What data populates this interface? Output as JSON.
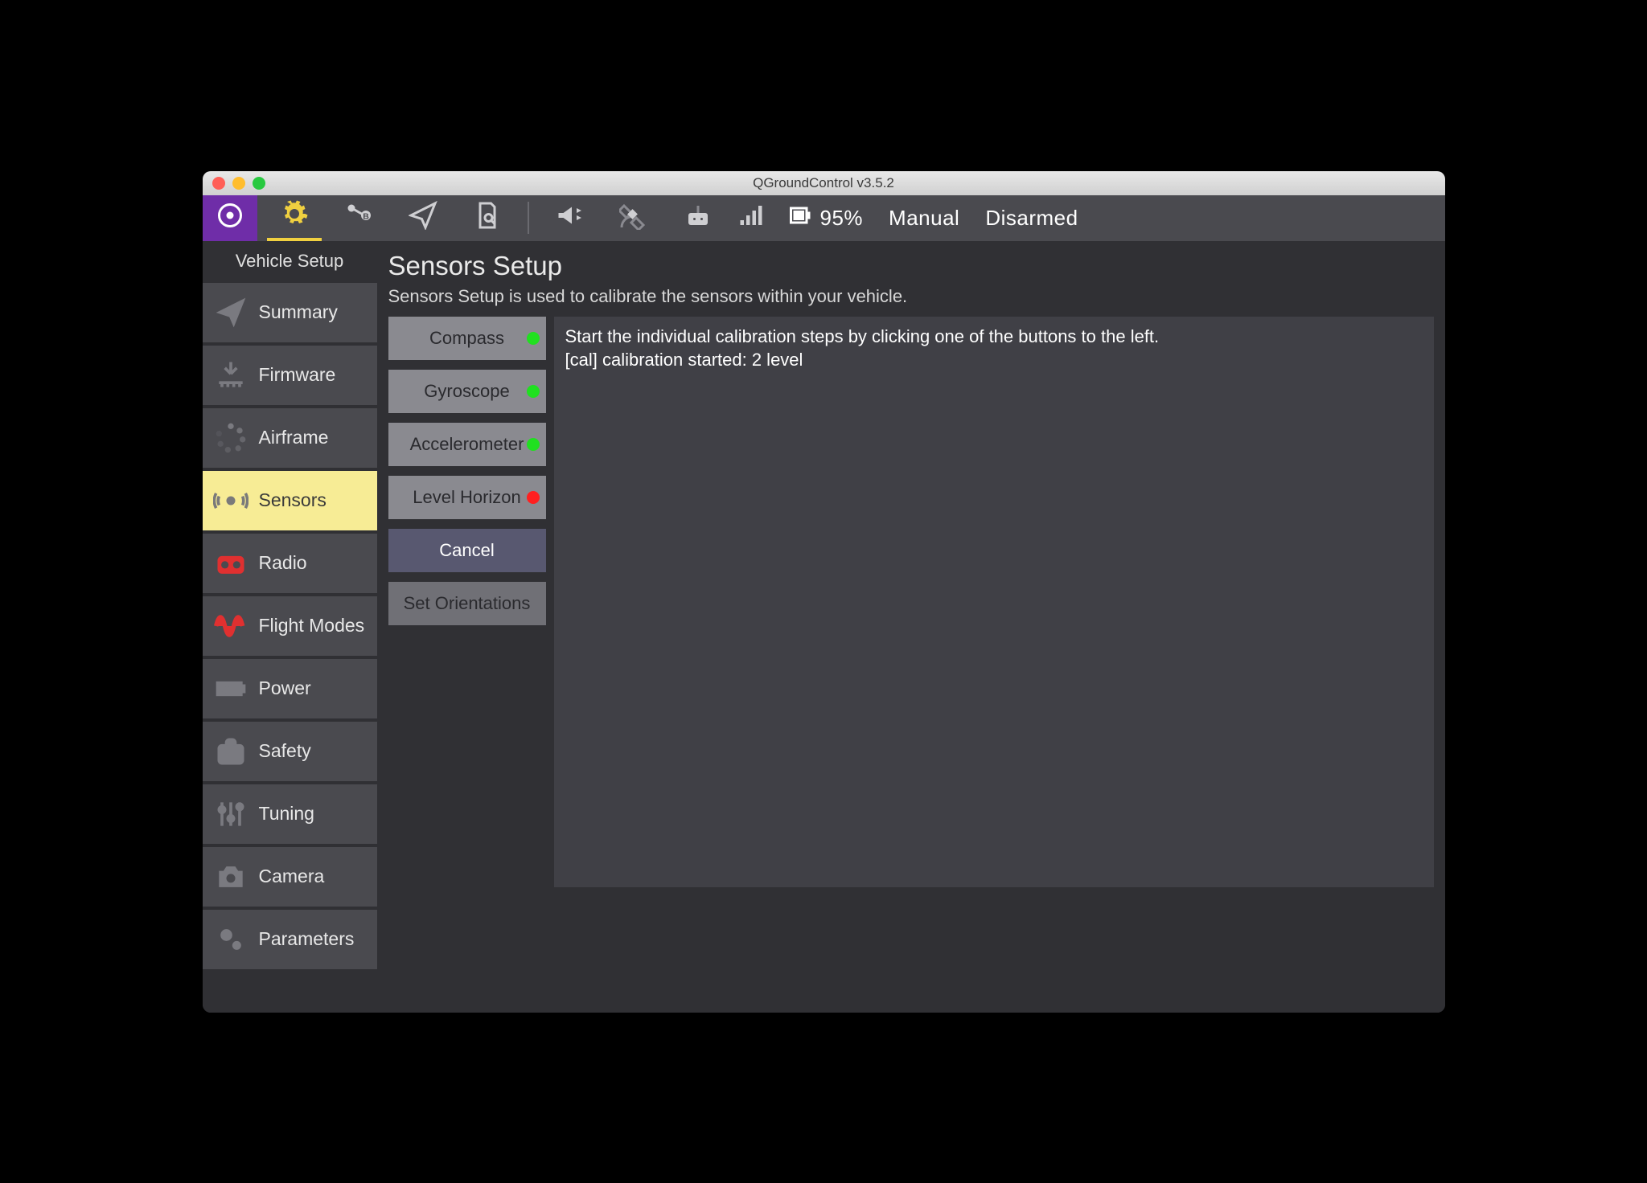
{
  "window": {
    "title": "QGroundControl v3.5.2"
  },
  "toolbar": {
    "battery": "95%",
    "mode": "Manual",
    "armed": "Disarmed"
  },
  "sidebar": {
    "title": "Vehicle Setup",
    "items": [
      {
        "label": "Summary"
      },
      {
        "label": "Firmware"
      },
      {
        "label": "Airframe"
      },
      {
        "label": "Sensors"
      },
      {
        "label": "Radio"
      },
      {
        "label": "Flight Modes"
      },
      {
        "label": "Power"
      },
      {
        "label": "Safety"
      },
      {
        "label": "Tuning"
      },
      {
        "label": "Camera"
      },
      {
        "label": "Parameters"
      }
    ]
  },
  "main": {
    "title": "Sensors Setup",
    "description": "Sensors Setup is used to calibrate the sensors within your vehicle.",
    "buttons": {
      "compass": "Compass",
      "gyroscope": "Gyroscope",
      "accelerometer": "Accelerometer",
      "level_horizon": "Level Horizon",
      "cancel": "Cancel",
      "set_orientations": "Set Orientations"
    },
    "panel": {
      "line1": "Start the individual calibration steps by clicking one of the buttons to the left.",
      "line2": "[cal] calibration started: 2 level"
    }
  },
  "colors": {
    "accent_purple": "#6f2da8",
    "accent_yellow": "#f0d040",
    "accent_red": "#e03030",
    "status_ok": "#20e020",
    "status_bad": "#ff2020"
  }
}
